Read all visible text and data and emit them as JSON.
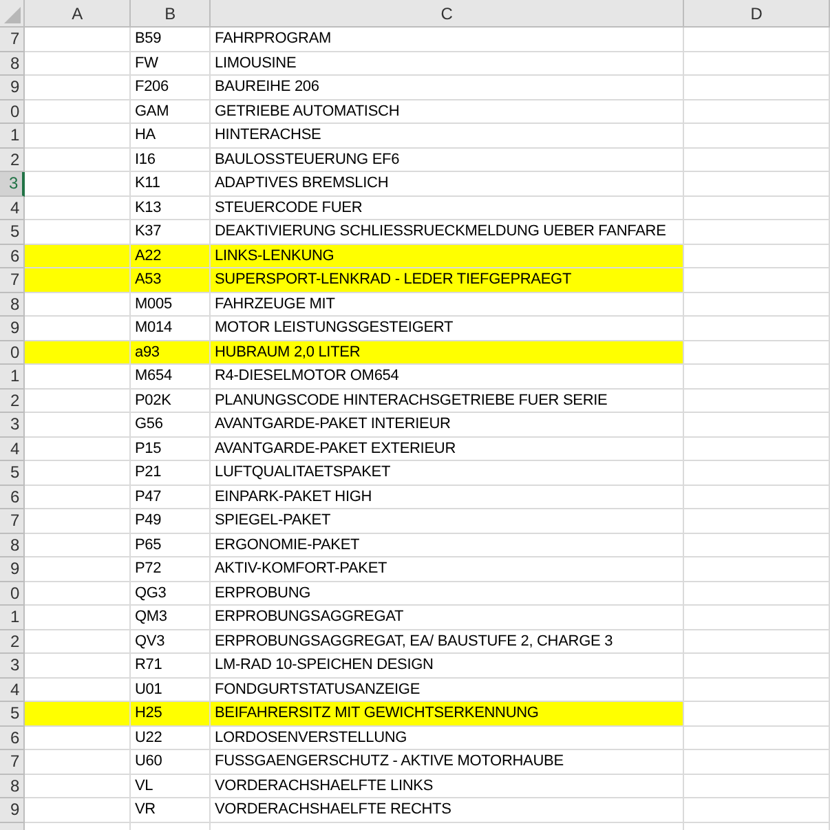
{
  "columns": [
    "A",
    "B",
    "C",
    "D"
  ],
  "rows": [
    {
      "number": "7",
      "code": "B59",
      "description": "FAHRPROGRAM",
      "highlighted": false,
      "selected": false
    },
    {
      "number": "8",
      "code": "FW",
      "description": "LIMOUSINE",
      "highlighted": false,
      "selected": false
    },
    {
      "number": "9",
      "code": "F206",
      "description": "BAUREIHE 206",
      "highlighted": false,
      "selected": false
    },
    {
      "number": "0",
      "code": "GAM",
      "description": "GETRIEBE AUTOMATISCH",
      "highlighted": false,
      "selected": false
    },
    {
      "number": "1",
      "code": "HA",
      "description": "HINTERACHSE",
      "highlighted": false,
      "selected": false
    },
    {
      "number": "2",
      "code": "I16",
      "description": "BAULOSSTEUERUNG EF6",
      "highlighted": false,
      "selected": false
    },
    {
      "number": "3",
      "code": "K11",
      "description": "ADAPTIVES BREMSLICH",
      "highlighted": false,
      "selected": true
    },
    {
      "number": "4",
      "code": "K13",
      "description": "STEUERCODE FUER",
      "highlighted": false,
      "selected": false
    },
    {
      "number": "5",
      "code": "K37",
      "description": "DEAKTIVIERUNG SCHLIESSRUECKMELDUNG UEBER FANFARE",
      "highlighted": false,
      "selected": false
    },
    {
      "number": "6",
      "code": "A22",
      "description": "LINKS-LENKUNG",
      "highlighted": true,
      "selected": false
    },
    {
      "number": "7",
      "code": "A53",
      "description": "SUPERSPORT-LENKRAD - LEDER TIEFGEPRAEGT",
      "highlighted": true,
      "selected": false
    },
    {
      "number": "8",
      "code": "M005",
      "description": "FAHRZEUGE MIT",
      "highlighted": false,
      "selected": false
    },
    {
      "number": "9",
      "code": "M014",
      "description": "MOTOR LEISTUNGSGESTEIGERT",
      "highlighted": false,
      "selected": false
    },
    {
      "number": "0",
      "code": "a93",
      "description": "HUBRAUM 2,0 LITER",
      "highlighted": true,
      "selected": false
    },
    {
      "number": "1",
      "code": "M654",
      "description": "R4-DIESELMOTOR OM654",
      "highlighted": false,
      "selected": false
    },
    {
      "number": "2",
      "code": "P02K",
      "description": "PLANUNGSCODE HINTERACHSGETRIEBE FUER SERIE",
      "highlighted": false,
      "selected": false
    },
    {
      "number": "3",
      "code": "G56",
      "description": "AVANTGARDE-PAKET INTERIEUR",
      "highlighted": false,
      "selected": false
    },
    {
      "number": "4",
      "code": "P15",
      "description": "AVANTGARDE-PAKET EXTERIEUR",
      "highlighted": false,
      "selected": false
    },
    {
      "number": "5",
      "code": "P21",
      "description": "LUFTQUALITAETSPAKET",
      "highlighted": false,
      "selected": false
    },
    {
      "number": "6",
      "code": "P47",
      "description": "EINPARK-PAKET HIGH",
      "highlighted": false,
      "selected": false
    },
    {
      "number": "7",
      "code": "P49",
      "description": "SPIEGEL-PAKET",
      "highlighted": false,
      "selected": false
    },
    {
      "number": "8",
      "code": "P65",
      "description": "ERGONOMIE-PAKET",
      "highlighted": false,
      "selected": false
    },
    {
      "number": "9",
      "code": "P72",
      "description": "AKTIV-KOMFORT-PAKET",
      "highlighted": false,
      "selected": false
    },
    {
      "number": "0",
      "code": "QG3",
      "description": "ERPROBUNG",
      "highlighted": false,
      "selected": false
    },
    {
      "number": "1",
      "code": "QM3",
      "description": "ERPROBUNGSAGGREGAT",
      "highlighted": false,
      "selected": false
    },
    {
      "number": "2",
      "code": "QV3",
      "description": "ERPROBUNGSAGGREGAT, EA/ BAUSTUFE 2, CHARGE 3",
      "highlighted": false,
      "selected": false
    },
    {
      "number": "3",
      "code": "R71",
      "description": "LM-RAD 10-SPEICHEN DESIGN",
      "highlighted": false,
      "selected": false
    },
    {
      "number": "4",
      "code": "U01",
      "description": "FONDGURTSTATUSANZEIGE",
      "highlighted": false,
      "selected": false
    },
    {
      "number": "5",
      "code": "H25",
      "description": "BEIFAHRERSITZ MIT GEWICHTSERKENNUNG",
      "highlighted": true,
      "selected": false
    },
    {
      "number": "6",
      "code": "U22",
      "description": "LORDOSENVERSTELLUNG",
      "highlighted": false,
      "selected": false
    },
    {
      "number": "7",
      "code": "U60",
      "description": "FUSSGAENGERSCHUTZ - AKTIVE MOTORHAUBE",
      "highlighted": false,
      "selected": false
    },
    {
      "number": "8",
      "code": "VL",
      "description": "VORDERACHSHAELFTE LINKS",
      "highlighted": false,
      "selected": false
    },
    {
      "number": "9",
      "code": "VR",
      "description": "VORDERACHSHAELFTE RECHTS",
      "highlighted": false,
      "selected": false
    }
  ]
}
